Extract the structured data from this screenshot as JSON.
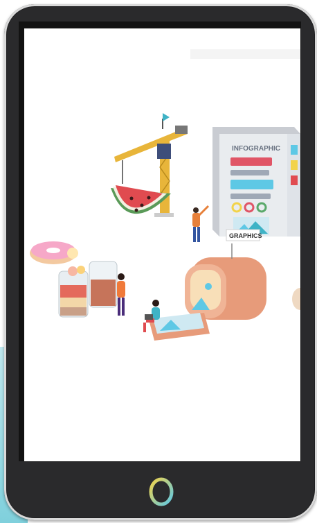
{
  "illustration": {
    "billboard_title": "INFOGRAPHIC",
    "sign_label": "GRAPHICS"
  },
  "device": {
    "home_button_icon": "circle-home-icon",
    "ring_colors": [
      "#f2d34a",
      "#5ec8e5"
    ]
  }
}
